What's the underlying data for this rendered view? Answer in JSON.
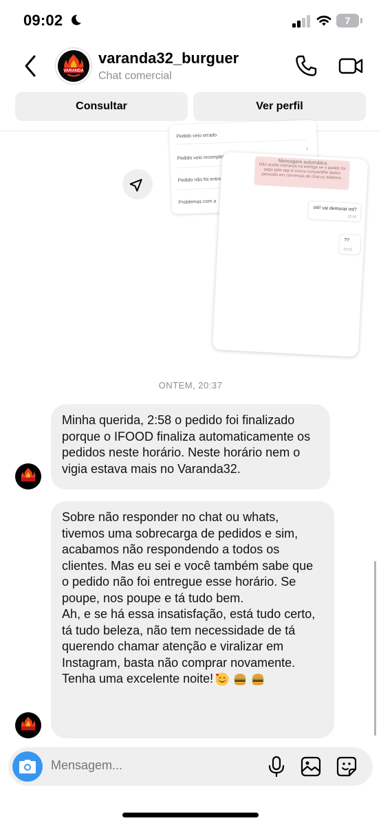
{
  "status_bar": {
    "time": "09:02",
    "battery_level": "7",
    "icons": [
      "moon-icon",
      "signal-icon",
      "wifi-icon",
      "battery-icon"
    ]
  },
  "header": {
    "name": "varanda32_burguer",
    "subtitle": "Chat comercial",
    "logo_text": "VARANDA",
    "icons": [
      "back-arrow-icon",
      "phone-icon",
      "video-camera-icon"
    ]
  },
  "actions": {
    "consultar": "Consultar",
    "ver_perfil": "Ver perfil"
  },
  "shared_image": {
    "menu_items": [
      "Pedido veio errado",
      "Pedido veio incompleto",
      "Pedido não foi entreg",
      "Problemas com a"
    ],
    "auto_title": "Mensagem automática",
    "auto_text": "Não aceite cobrança na entrega se o pedido foi pago pelo app e nunca compartilhe dados pessoais em conversas de chat ou telefone.",
    "msg1": "oiii! vai demorar mt?",
    "msg1_time": "22:16",
    "msg2": "??",
    "msg2_time": "22:21"
  },
  "conversation": {
    "timestamp": "ONTEM, 20:37",
    "messages": [
      {
        "paragraphs": [
          "Minha querida, 2:58 o pedido foi finalizado porque o IFOOD finaliza automaticamente os pedidos neste horário. Neste horário nem o vigia estava mais no Varanda32."
        ]
      },
      {
        "paragraphs": [
          "Sobre não responder no chat ou whats, tivemos uma sobrecarga de pedidos e sim, acabamos não respondendo a todos os clientes. Mas eu sei e você também sabe que o pedido não foi entregue esse horário. Se poupe, nos poupe e tá tudo bem.",
          "Ah, e se há essa insatisfação, está tudo certo, tá tudo beleza, não tem necessidade de tá querendo chamar atenção e viralizar em Instagram, basta não comprar novamente."
        ],
        "last_line": "Tenha uma excelente noite!",
        "emojis": [
          "smiling-face-with-hearts-emoji",
          "hamburger-emoji",
          "hamburger-emoji"
        ]
      }
    ]
  },
  "composer": {
    "placeholder": "Mensagem...",
    "icons": [
      "camera-icon",
      "microphone-icon",
      "gallery-icon",
      "sticker-icon"
    ]
  },
  "colors": {
    "accent": "#3797f0",
    "bubble": "#efefef",
    "secondary_text": "#8e8e8e"
  }
}
